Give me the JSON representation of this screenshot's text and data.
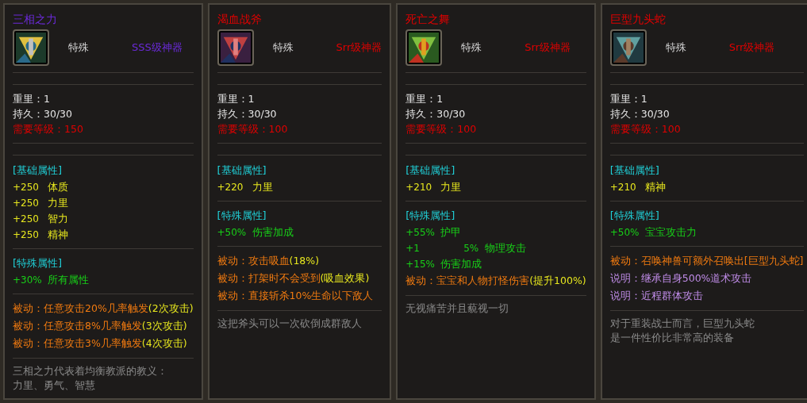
{
  "cards": [
    {
      "name": {
        "text": "三相之力",
        "color": "#6a2ad8"
      },
      "type": "特殊",
      "grade": {
        "text": "SSS级神器",
        "color": "#6a2ad8"
      },
      "stats": [
        {
          "label": "重里：",
          "value": "1",
          "kind": "plain"
        },
        {
          "label": "持久：",
          "value": "30/30",
          "kind": "plain"
        },
        {
          "label": "需要等级：",
          "value": "150",
          "kind": "requirement"
        }
      ],
      "sections": [
        {
          "heading": "[基础属性]",
          "lines": [
            {
              "kind": "stat",
              "value": "+250",
              "label": "体质",
              "color": "#e6e61e"
            },
            {
              "kind": "stat",
              "value": "+250",
              "label": "力里",
              "color": "#e6e61e"
            },
            {
              "kind": "stat",
              "value": "+250",
              "label": "智力",
              "color": "#e6e61e"
            },
            {
              "kind": "stat",
              "value": "+250",
              "label": "精神",
              "color": "#e6e61e"
            }
          ]
        },
        {
          "heading": "[特殊属性]",
          "lines": [
            {
              "kind": "stat",
              "value": "+30%",
              "label": "所有属性",
              "color": "#18d018"
            }
          ]
        },
        {
          "lines": [
            {
              "kind": "text",
              "segments": [
                {
                  "text": "被动：任意攻击20%几率触发",
                  "color": "#f07a10"
                },
                {
                  "text": "(2次攻击)",
                  "color": "#e6e61e"
                }
              ]
            },
            {
              "kind": "text",
              "segments": [
                {
                  "text": "被动：任意攻击8%几率触发",
                  "color": "#f07a10"
                },
                {
                  "text": "(3次攻击)",
                  "color": "#e6e61e"
                }
              ]
            },
            {
              "kind": "text",
              "segments": [
                {
                  "text": "被动：任意攻击3%几率触发",
                  "color": "#f07a10"
                },
                {
                  "text": "(4次攻击)",
                  "color": "#e6e61e"
                }
              ]
            }
          ]
        }
      ],
      "description": [
        "三相之力代表着均衡教派的教义：",
        "力里、勇气、智慧"
      ]
    },
    {
      "name": {
        "text": "渴血战斧",
        "color": "#e00000"
      },
      "type": "特殊",
      "grade": {
        "text": "Srr级神器",
        "color": "#e00000"
      },
      "stats": [
        {
          "label": "重里：",
          "value": "1",
          "kind": "plain"
        },
        {
          "label": "持久：",
          "value": "30/30",
          "kind": "plain"
        },
        {
          "label": "需要等级：",
          "value": "100",
          "kind": "requirement"
        }
      ],
      "sections": [
        {
          "heading": "[基础属性]",
          "lines": [
            {
              "kind": "stat",
              "value": "+220",
              "label": "力里",
              "color": "#e6e61e"
            }
          ]
        },
        {
          "heading": "[特殊属性]",
          "lines": [
            {
              "kind": "stat",
              "value": "+50%",
              "label": "伤害加成",
              "color": "#18d018"
            }
          ]
        },
        {
          "lines": [
            {
              "kind": "text",
              "segments": [
                {
                  "text": "被动：攻击吸血",
                  "color": "#f07a10"
                },
                {
                  "text": "(18%)",
                  "color": "#e6e61e"
                }
              ]
            },
            {
              "kind": "text",
              "segments": [
                {
                  "text": "被动：打架时不会受到",
                  "color": "#f07a10"
                },
                {
                  "text": "(吸血效果)",
                  "color": "#e6e61e"
                }
              ]
            },
            {
              "kind": "text",
              "segments": [
                {
                  "text": "被动：直接斩杀10%生命以下敌人",
                  "color": "#f07a10"
                }
              ]
            }
          ]
        }
      ],
      "description": [
        "这把斧头可以一次砍倒成群敌人"
      ]
    },
    {
      "name": {
        "text": "死亡之舞",
        "color": "#e00000"
      },
      "type": "特殊",
      "grade": {
        "text": "Srr级神器",
        "color": "#e00000"
      },
      "stats": [
        {
          "label": "重里：",
          "value": "1",
          "kind": "plain"
        },
        {
          "label": "持久：",
          "value": "30/30",
          "kind": "plain"
        },
        {
          "label": "需要等级：",
          "value": "100",
          "kind": "requirement"
        }
      ],
      "sections": [
        {
          "heading": "[基础属性]",
          "lines": [
            {
              "kind": "stat",
              "value": "+210",
              "label": "力里",
              "color": "#e6e61e"
            }
          ]
        },
        {
          "heading": "[特殊属性]",
          "lines": [
            {
              "kind": "stat",
              "value": "+55%",
              "label": "护甲",
              "color": "#18d018"
            },
            {
              "kind": "stat",
              "value": "+1",
              "extra": "5%",
              "label": "物理攻击",
              "color": "#18d018"
            },
            {
              "kind": "stat",
              "value": "+15%",
              "label": "伤害加成",
              "color": "#18d018"
            },
            {
              "kind": "text",
              "segments": [
                {
                  "text": "被动：宝宝和人物打怪伤害",
                  "color": "#f07a10"
                },
                {
                  "text": "(提升100%)",
                  "color": "#e6e61e"
                }
              ]
            }
          ]
        }
      ],
      "description": [
        "无视痛苦并且藐视一切"
      ]
    },
    {
      "name": {
        "text": "巨型九头蛇",
        "color": "#e00000"
      },
      "type": "特殊",
      "grade": {
        "text": "Srr级神器",
        "color": "#e00000"
      },
      "stats": [
        {
          "label": "重里：",
          "value": "1",
          "kind": "plain"
        },
        {
          "label": "持久：",
          "value": "30/30",
          "kind": "plain"
        },
        {
          "label": "需要等级：",
          "value": "100",
          "kind": "requirement"
        }
      ],
      "sections": [
        {
          "heading": "[基础属性]",
          "lines": [
            {
              "kind": "stat",
              "value": "+210",
              "label": "精神",
              "color": "#e6e61e"
            }
          ]
        },
        {
          "heading": "[特殊属性]",
          "lines": [
            {
              "kind": "stat",
              "value": "+50%",
              "label": "宝宝攻击力",
              "color": "#18d018"
            }
          ]
        },
        {
          "lines": [
            {
              "kind": "text",
              "segments": [
                {
                  "text": "被动：召唤神兽可额外召唤出[巨型九头蛇]",
                  "color": "#f07a10"
                }
              ]
            },
            {
              "kind": "text",
              "segments": [
                {
                  "text": "说明：继承自身500%道术攻击",
                  "color": "#c08ce8"
                }
              ]
            },
            {
              "kind": "text",
              "segments": [
                {
                  "text": "说明：近程群体攻击",
                  "color": "#c08ce8"
                }
              ]
            }
          ]
        }
      ],
      "description": [
        "对于重装战士而言，巨型九头蛇",
        "是一件性价比非常高的装备"
      ]
    }
  ]
}
